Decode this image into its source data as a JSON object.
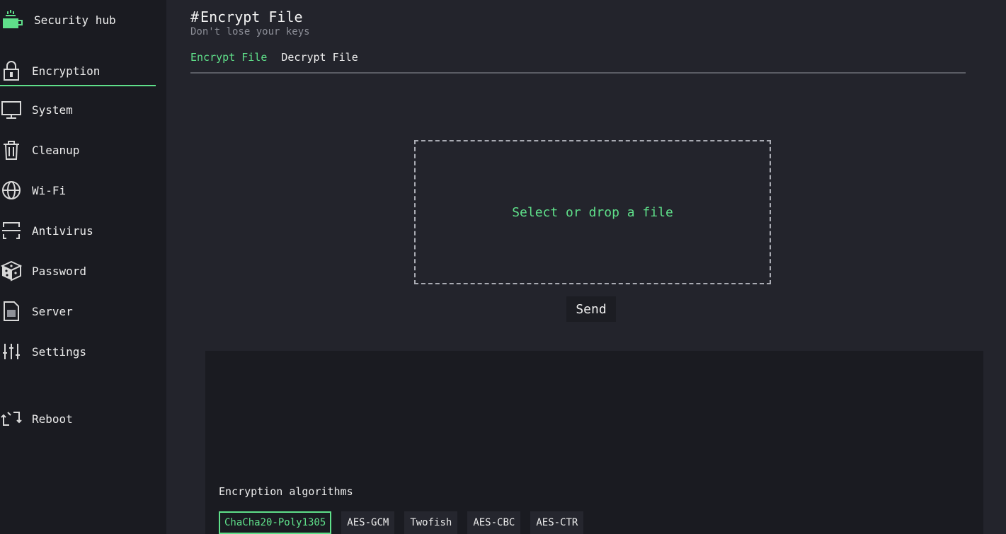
{
  "app": {
    "name": "Security hub",
    "logo_icon": "coffee-cup-icon"
  },
  "sidebar": {
    "items": [
      {
        "label": "Encryption",
        "icon": "lock-icon",
        "active": true
      },
      {
        "label": "System",
        "icon": "monitor-icon",
        "active": false
      },
      {
        "label": "Cleanup",
        "icon": "trash-icon",
        "active": false
      },
      {
        "label": "Wi-Fi",
        "icon": "globe-icon",
        "active": false
      },
      {
        "label": "Antivirus",
        "icon": "scanner-icon",
        "active": false
      },
      {
        "label": "Password",
        "icon": "dice-icon",
        "active": false
      },
      {
        "label": "Server",
        "icon": "server-document-icon",
        "active": false
      },
      {
        "label": "Settings",
        "icon": "sliders-icon",
        "active": false
      },
      {
        "label": "Reboot",
        "icon": "reboot-icon",
        "active": false
      }
    ]
  },
  "main": {
    "title_hash": "#",
    "title": "Encrypt File",
    "subtitle": "Don't lose your keys",
    "tabs": [
      {
        "label": "Encrypt File",
        "active": true
      },
      {
        "label": "Decrypt File",
        "active": false
      }
    ],
    "dropzone_label": "Select or drop a file",
    "send_label": "Send"
  },
  "algorithms": {
    "title": "Encryption algorithms",
    "options": [
      "ChaCha20-Poly1305",
      "AES-GCM",
      "Twofish",
      "AES-CBC",
      "AES-CTR"
    ],
    "selected": "ChaCha20-Poly1305"
  },
  "colors": {
    "accent": "#5fe08a",
    "background": "#23242c",
    "sidebar": "#1a1b21"
  }
}
